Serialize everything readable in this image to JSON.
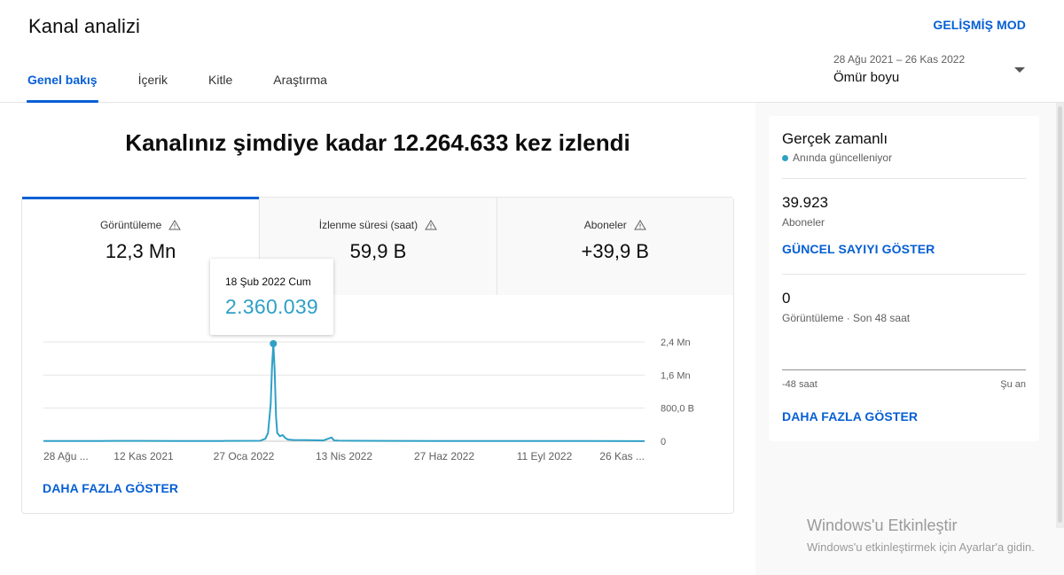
{
  "header": {
    "title": "Kanal analizi",
    "advanced_mode": "GELİŞMİŞ MOD",
    "tabs": [
      {
        "label": "Genel bakış",
        "active": true
      },
      {
        "label": "İçerik",
        "active": false
      },
      {
        "label": "Kitle",
        "active": false
      },
      {
        "label": "Araştırma",
        "active": false
      }
    ],
    "date_range": {
      "range_text": "28 Ağu 2021 – 26 Kas 2022",
      "selected": "Ömür boyu"
    }
  },
  "main": {
    "headline": "Kanalınız şimdiye kadar 12.264.633 kez izlendi",
    "metrics": [
      {
        "label": "Görüntüleme",
        "value": "12,3 Mn",
        "active": true,
        "icon": "warning-icon"
      },
      {
        "label": "İzlenme süresi (saat)",
        "value": "59,9 B",
        "active": false,
        "icon": "warning-icon"
      },
      {
        "label": "Aboneler",
        "value": "+39,9 B",
        "active": false,
        "icon": "warning-icon"
      }
    ],
    "more_link": "DAHA FAZLA GÖSTER",
    "tooltip": {
      "date": "18 Şub 2022 Cum",
      "value": "2.360.039"
    }
  },
  "chart_data": {
    "type": "line",
    "x_tick_labels": [
      "28 Ağu ...",
      "12 Kas 2021",
      "27 Oca 2022",
      "13 Nis 2022",
      "27 Haz 2022",
      "11 Eyl 2022",
      "26 Kas ..."
    ],
    "y_tick_labels": [
      "2,4 Mn",
      "1,6 Mn",
      "800,0 B",
      "0"
    ],
    "y_ticks": [
      2400000,
      1600000,
      800000,
      0
    ],
    "ylim": [
      0,
      2400000
    ],
    "color": "#2fa0c6",
    "series": [
      {
        "x": [
          "2021-08-28",
          "2021-10-10",
          "2021-11-12",
          "2021-12-10",
          "2022-01-10",
          "2022-02-08",
          "2022-02-12",
          "2022-02-14",
          "2022-02-16",
          "2022-02-17",
          "2022-02-18",
          "2022-02-19",
          "2022-02-20",
          "2022-02-21",
          "2022-02-23",
          "2022-02-25",
          "2022-02-27",
          "2022-03-01",
          "2022-03-05",
          "2022-03-15",
          "2022-03-28",
          "2022-04-03",
          "2022-04-05",
          "2022-04-08",
          "2022-04-20",
          "2022-05-15",
          "2022-06-27",
          "2022-08-01",
          "2022-09-11",
          "2022-10-15",
          "2022-11-26"
        ],
        "values": [
          5000,
          6000,
          8000,
          5000,
          6000,
          10000,
          60000,
          200000,
          900000,
          1800000,
          2360039,
          1700000,
          600000,
          200000,
          120000,
          150000,
          80000,
          40000,
          30000,
          25000,
          20000,
          90000,
          20000,
          15000,
          10000,
          8000,
          6000,
          5000,
          5000,
          4000,
          3000
        ]
      }
    ],
    "grid": true
  },
  "sidebar": {
    "title": "Gerçek zamanlı",
    "subtitle": "Anında güncelleniyor",
    "subscribers_value": "39.923",
    "subscribers_label": "Aboneler",
    "show_current_count": "GÜNCEL SAYIYI GÖSTER",
    "views_value": "0",
    "views_label": "Görüntüleme · Son 48 saat",
    "axis_left": "-48 saat",
    "axis_right": "Şu an",
    "more_link": "DAHA FAZLA GÖSTER"
  },
  "watermark": {
    "line1": "Windows'u Etkinleştir",
    "line2": "Windows'u etkinleştirmek için Ayarlar'a gidin."
  }
}
